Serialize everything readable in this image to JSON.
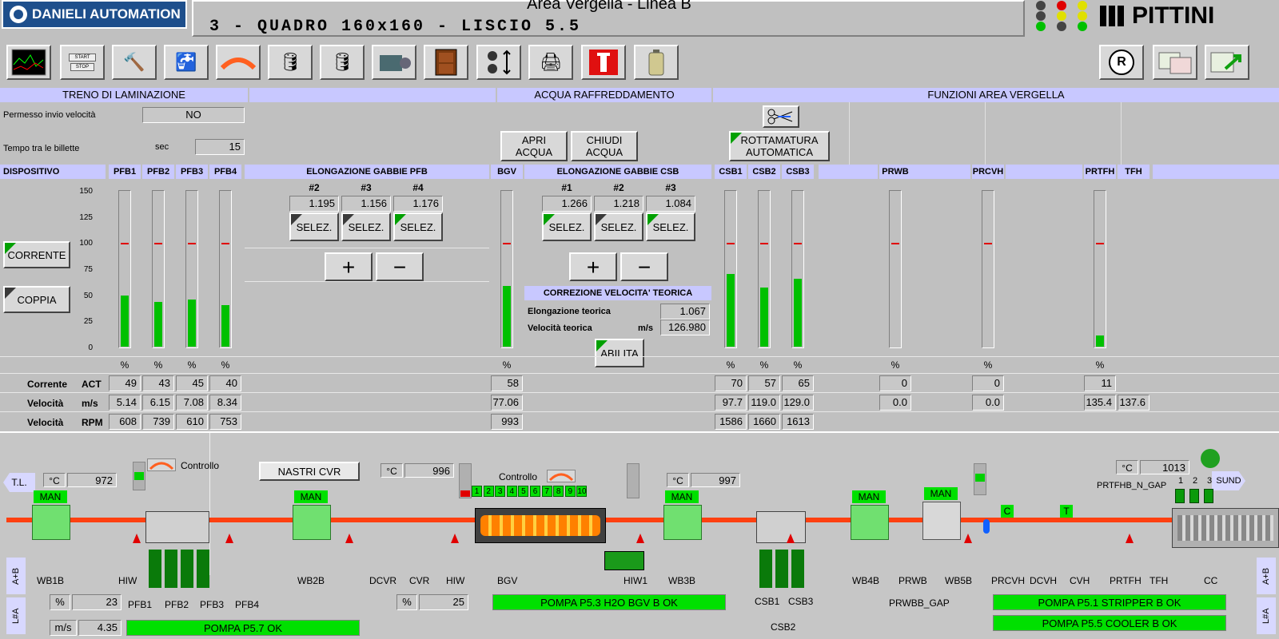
{
  "header": {
    "logo": "DANIELI AUTOMATION",
    "title": "Area Vergella - Linea B",
    "subtitle": "3 - QUADRO 160x160 - LISCIO 5.5",
    "brand": "PITTINI"
  },
  "toolbar": {
    "icons": [
      "trend-icon",
      "start-stop-icon",
      "tools-icon",
      "water-tap-icon",
      "hot-bar-icon",
      "oil-can-icon",
      "oil-can-2-icon",
      "motor-icon",
      "door-icon",
      "selector-icon",
      "printer-icon",
      "fire-extinguisher-icon",
      "battery-icon"
    ],
    "start": "START",
    "stop": "STOP",
    "reset": "R"
  },
  "sections": {
    "treno": "TRENO DI LAMINAZIONE",
    "acqua": "ACQUA RAFFREDDAMENTO",
    "funzioni": "FUNZIONI AREA VERGELLA"
  },
  "treno": {
    "permesso_label": "Permesso invio velocità",
    "permesso_value": "NO",
    "tempo_label": "Tempo tra le billette",
    "tempo_unit": "sec",
    "tempo_value": "15"
  },
  "acqua": {
    "apri": "APRI\nACQUA",
    "chiudi": "CHIUDI\nACQUA"
  },
  "funzioni": {
    "rottamatura": "ROTTAMATURA\nAUTOMATICA"
  },
  "table": {
    "dispositivo": "DISPOSITIVO",
    "columns": [
      "PFB1",
      "PFB2",
      "PFB3",
      "PFB4",
      "BGV",
      "CSB1",
      "CSB2",
      "CSB3",
      "PRWB",
      "PRCVH",
      "PRTFH",
      "TFH"
    ],
    "elong_pfb": "ELONGAZIONE GABBIE PFB",
    "elong_csb": "ELONGAZIONE GABBIE CSB",
    "scale": [
      "150",
      "125",
      "100",
      "75",
      "50",
      "25",
      "0"
    ],
    "pct": "%",
    "btn_corrente": "CORRENTE",
    "btn_coppia": "COPPIA",
    "pfb_elong": [
      {
        "n": "#2",
        "v": "1.195"
      },
      {
        "n": "#3",
        "v": "1.156"
      },
      {
        "n": "#4",
        "v": "1.176"
      }
    ],
    "csb_elong": [
      {
        "n": "#1",
        "v": "1.266"
      },
      {
        "n": "#2",
        "v": "1.218"
      },
      {
        "n": "#3",
        "v": "1.084"
      }
    ],
    "selez": "SELEZ.",
    "plus": "+",
    "minus": "−",
    "correzione": "CORREZIONE VELOCITA' TEORICA",
    "elong_teorica_label": "Elongazione teorica",
    "elong_teorica_value": "1.067",
    "vel_teorica_label": "Velocità teorica",
    "vel_teorica_unit": "m/s",
    "vel_teorica_value": "126.980",
    "abilita": "ABILITA",
    "bars": {
      "PFB1": 49,
      "PFB2": 43,
      "PFB3": 45,
      "PFB4": 40,
      "BGV": 58,
      "CSB1": 70,
      "CSB2": 57,
      "CSB3": 65,
      "PRWB": 0,
      "PRCVH": 0,
      "PRTFH": 11
    },
    "rows": [
      {
        "label": "Corrente",
        "unit": "ACT",
        "values": {
          "PFB1": "49",
          "PFB2": "43",
          "PFB3": "45",
          "PFB4": "40",
          "BGV": "58",
          "CSB1": "70",
          "CSB2": "57",
          "CSB3": "65",
          "PRWB": "0",
          "PRCVH": "0",
          "PRTFH": "11"
        }
      },
      {
        "label": "Velocità",
        "unit": "m/s",
        "values": {
          "PFB1": "5.14",
          "PFB2": "6.15",
          "PFB3": "7.08",
          "PFB4": "8.34",
          "BGV": "77.06",
          "CSB1": "97.7",
          "CSB2": "119.0",
          "CSB3": "129.0",
          "PRWB": "0.0",
          "PRCVH": "0.0",
          "PRTFH": "135.4",
          "TFH": "137.6"
        }
      },
      {
        "label": "Velocità",
        "unit": "RPM",
        "values": {
          "PFB1": "608",
          "PFB2": "739",
          "PFB3": "610",
          "PFB4": "753",
          "BGV": "993",
          "CSB1": "1586",
          "CSB2": "1660",
          "CSB3": "1613"
        }
      }
    ]
  },
  "process": {
    "tl": "T.L.",
    "sund": "SUND",
    "temp_unit": "°C",
    "temps": [
      "972",
      "996",
      "997",
      "1013"
    ],
    "controllo": "Controllo",
    "nastri": "NASTRI CVR",
    "man": "MAN",
    "bgv_boxes": [
      "1",
      "2",
      "3",
      "4",
      "5",
      "6",
      "7",
      "8",
      "9",
      "10"
    ],
    "cc_boxes": [
      "1",
      "2",
      "3"
    ],
    "prtfhb": "PRTFHB_N_GAP",
    "labels": [
      "WB1B",
      "HIW",
      "PFB1",
      "PFB2",
      "PFB3",
      "PFB4",
      "WB2B",
      "DCVR",
      "CVR",
      "HIW",
      "BGV",
      "HIW1",
      "WB3B",
      "CSB1",
      "CSB3",
      "CSB2",
      "WB4B",
      "PRWB",
      "WB5B",
      "PRWBB_GAP",
      "PRCVH",
      "DCVH",
      "CVH",
      "PRTFH",
      "TFH",
      "CC"
    ],
    "c": "C",
    "t": "T",
    "ab": "A+B",
    "lha": "L#A",
    "pct": "%",
    "pct1": "23",
    "pct2": "25",
    "ms": "m/s",
    "ms_val": "4.35",
    "pumps": [
      "POMPA P5.7 OK",
      "POMPA P5.3 H2O BGV B OK",
      "POMPA P5.1 STRIPPER B OK",
      "POMPA P5.5 COOLER B OK"
    ]
  }
}
